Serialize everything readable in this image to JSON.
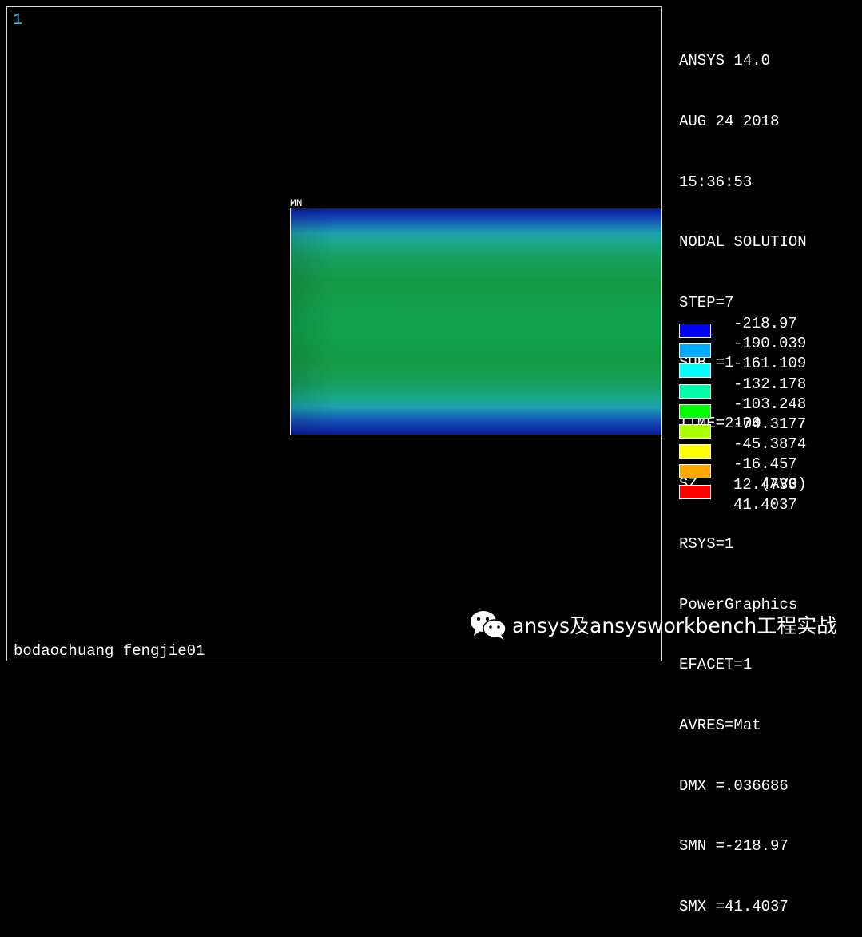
{
  "graphics_window": {
    "window_number": "1",
    "mn_label": "MN",
    "footer_title": "bodaochuang fengjie01"
  },
  "info_panel": [
    "ANSYS 14.0",
    "AUG 24 2018",
    "15:36:53",
    "NODAL SOLUTION",
    "STEP=7",
    "SUB =1",
    "TIME=2100",
    "SZ       (AVG)",
    "RSYS=1",
    "PowerGraphics",
    "EFACET=1",
    "AVRES=Mat",
    "DMX =.036686",
    "SMN =-218.97",
    "SMX =41.4037"
  ],
  "legend": {
    "colors": [
      "#0000ff",
      "#00aaff",
      "#00ffff",
      "#00ffaa",
      "#00ff00",
      "#aaff00",
      "#ffff00",
      "#ffaa00",
      "#ff0000"
    ],
    "values": [
      "-218.97",
      "-190.039",
      "-161.109",
      "-132.178",
      "-103.248",
      "-74.3177",
      "-45.3874",
      "-16.457",
      "12.4733",
      "41.4037"
    ]
  },
  "watermark": {
    "icon": "wechat-icon",
    "text": "ansys及ansysworkbench工程实战"
  }
}
